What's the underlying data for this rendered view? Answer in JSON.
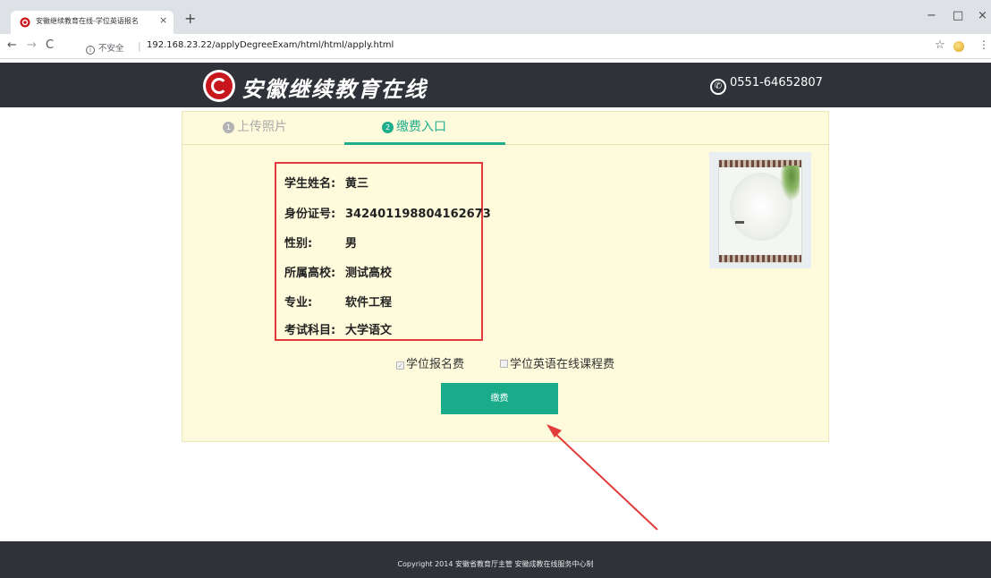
{
  "browser": {
    "tab_title": "安徽继续教育在线-学位英语报名",
    "tab_close": "×",
    "new_tab": "+",
    "url_security": "不安全",
    "url": "192.168.23.22/applyDegreeExam/html/html/apply.html",
    "nav_back": "←",
    "nav_forward": "→",
    "nav_reload": "C",
    "win_minimize": "−",
    "win_restore": "□",
    "win_close": "×",
    "bookmark_star": "☆",
    "menu": "⋮"
  },
  "site": {
    "name": "安徽继续教育在线",
    "phone": "0551-64652807"
  },
  "steps": [
    {
      "num": "1",
      "label": "上传照片",
      "active": false
    },
    {
      "num": "2",
      "label": "缴费入口",
      "active": true
    }
  ],
  "student": {
    "name_label": "学生姓名:",
    "name_value": "黄三",
    "id_label": "身份证号:",
    "id_value": "342401198804162673",
    "gender_label": "性别:",
    "gender_value": "男",
    "school_label": "所属高校:",
    "school_value": "测试高校",
    "major_label": "专业:",
    "major_value": "软件工程",
    "subject_label": "考试科目:",
    "subject_value": "大学语文"
  },
  "fees": {
    "degree_fee_label": "学位报名费",
    "degree_fee_checked": true,
    "course_fee_label": "学位英语在线课程费",
    "course_fee_checked": false
  },
  "pay_button": "缴费",
  "footer": {
    "copyright": "Copyright 2014 安徽省教育厅主管 安徽成教在线服务中心制"
  },
  "colors": {
    "accent": "#1aab8a",
    "header_bg": "#2f3238",
    "panel_bg": "#fefbdc",
    "highlight_box": "#e0393e"
  }
}
